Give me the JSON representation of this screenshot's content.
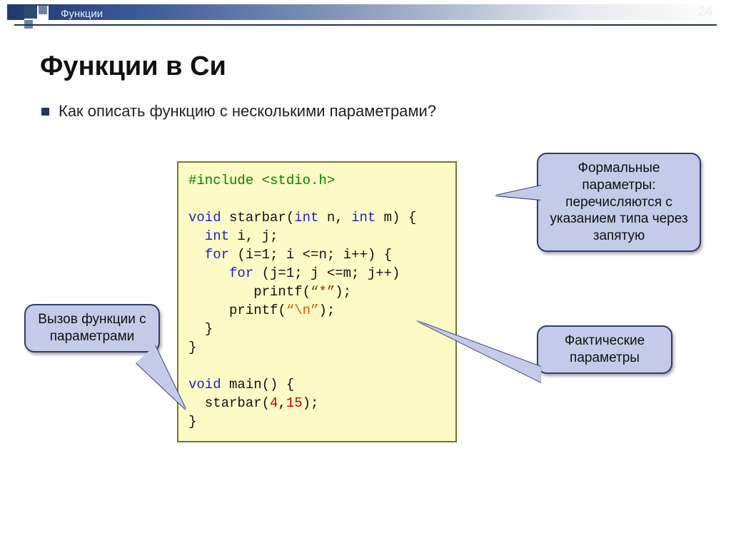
{
  "header": {
    "breadcrumb": "Функции",
    "page_number": "24"
  },
  "title": "Функции в Си",
  "bullet": "Как описать функцию с несколькими параметрами?",
  "code": {
    "l1a": "#include ",
    "l1b": "<stdio.h>",
    "blank": "",
    "l2a": "void ",
    "l2b": "starbar(",
    "l2c": "int ",
    "l2d": "n, ",
    "l2e": "int ",
    "l2f": "m) {",
    "l3a": "  int ",
    "l3b": "i, j;",
    "l4a": "  for ",
    "l4b": "(i=1; i <=n; i++) {",
    "l5a": "     for ",
    "l5b": "(j=1; j <=m; j++)",
    "l6a": "        printf(",
    "l6b": "“*”",
    "l6c": ");",
    "l7a": "     printf(",
    "l7b": "“\\n”",
    "l7c": ");",
    "l8": "  }",
    "l9": "}",
    "l10a": "void ",
    "l10b": "main() {",
    "l11a": "  starbar(",
    "l11b": "4",
    "l11c": ",",
    "l11d": "15",
    "l11e": ");",
    "l12": "}"
  },
  "callouts": {
    "formal": "Формальные параметры: перечисляются с указанием типа через запятую",
    "call": "Вызов функции с параметрами",
    "actual": "Фактические параметры"
  }
}
